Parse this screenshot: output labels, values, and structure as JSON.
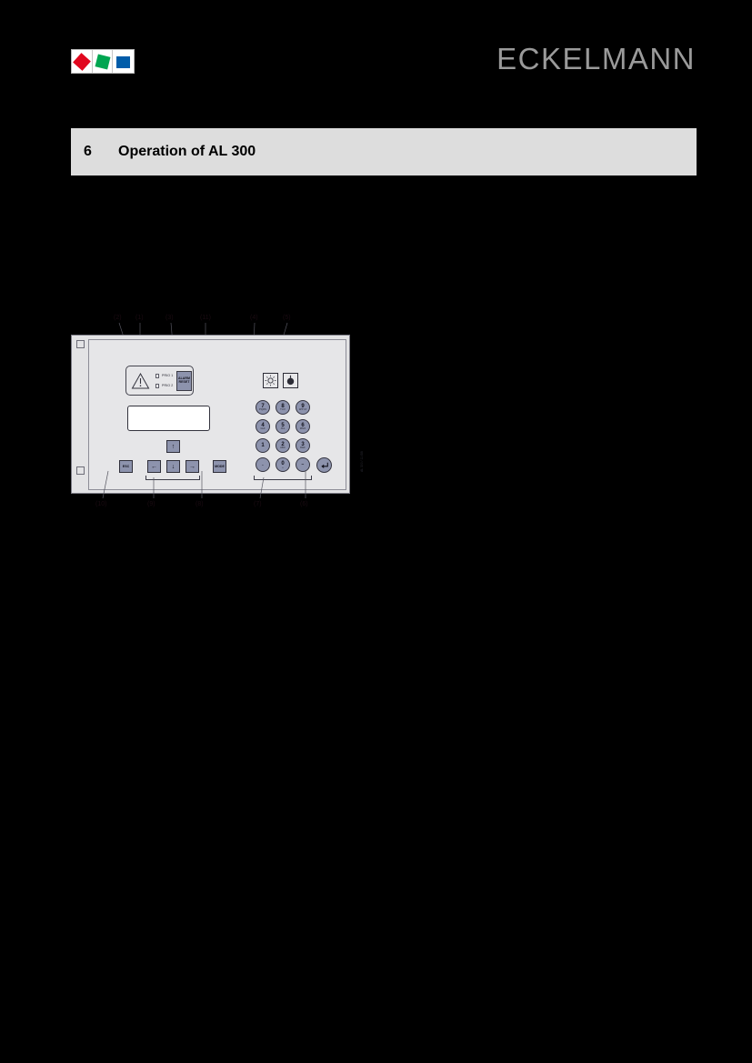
{
  "header": {
    "logo_name": "eckelmann-logo",
    "logo_colors": {
      "red": "#e1081f",
      "green": "#00a651",
      "blue": "#005ca9"
    },
    "wordmark": "ECKELMANN",
    "wordmark_color": "#9a9a9a"
  },
  "chapter": {
    "number": "6",
    "title": "Operation of AL 300",
    "bar_color": "#dddddd"
  },
  "figure": {
    "name": "al-300-front-panel-diagram",
    "callouts_top": [
      {
        "label": "(2)",
        "target": "prio-2-led"
      },
      {
        "label": "(1)",
        "target": "prio-1-led"
      },
      {
        "label": "(3)",
        "target": "alarm-reset-button"
      },
      {
        "label": "(11)",
        "target": "lcd-display"
      },
      {
        "label": "(4)",
        "target": "lamp-test-button"
      },
      {
        "label": "(5)",
        "target": "horn-button"
      }
    ],
    "callouts_bottom": [
      {
        "label": "(10)",
        "target": "esc-key"
      },
      {
        "label": "(9)",
        "target": "arrow-keys"
      },
      {
        "label": "(8)",
        "target": "mode-key"
      },
      {
        "label": "(7)",
        "target": "numeric-keypad"
      },
      {
        "label": "(6)",
        "target": "enter-key"
      }
    ],
    "alarm_group": {
      "warning_icon": "warning-triangle-icon",
      "prio_1_label": "PRIO 1",
      "prio_2_label": "PRIO 2",
      "alarm_reset_line1": "ALARM",
      "alarm_reset_line2": "RESET"
    },
    "icon_buttons": [
      {
        "name": "lamp-test-icon",
        "glyph": "lamp"
      },
      {
        "name": "horn-icon",
        "glyph": "horn"
      }
    ],
    "function_keys": [
      {
        "name": "esc-key",
        "label": "ESC"
      },
      {
        "name": "arrow-up-key",
        "label": "↑"
      },
      {
        "name": "arrow-left-key",
        "label": "←"
      },
      {
        "name": "arrow-down-key",
        "label": "↓"
      },
      {
        "name": "arrow-right-key",
        "label": "→"
      },
      {
        "name": "mode-key",
        "label": "MODE"
      }
    ],
    "keypad": [
      {
        "digit": "7",
        "sub": "PQRS"
      },
      {
        "digit": "8",
        "sub": "TUV"
      },
      {
        "digit": "9",
        "sub": "WXYZ"
      },
      {
        "digit": "4",
        "sub": "GHI"
      },
      {
        "digit": "5",
        "sub": "JKL"
      },
      {
        "digit": "6",
        "sub": "MNO"
      },
      {
        "digit": "1",
        "sub": ""
      },
      {
        "digit": "2",
        "sub": "ABC"
      },
      {
        "digit": "3",
        "sub": "DEF"
      },
      {
        "digit": ".",
        "sub": ""
      },
      {
        "digit": "0",
        "sub": "␣"
      },
      {
        "digit": "−",
        "sub": ""
      }
    ],
    "enter_key": {
      "name": "enter-key",
      "label": "↵"
    },
    "drawing_reference": "AL 300 / 11 GB"
  }
}
